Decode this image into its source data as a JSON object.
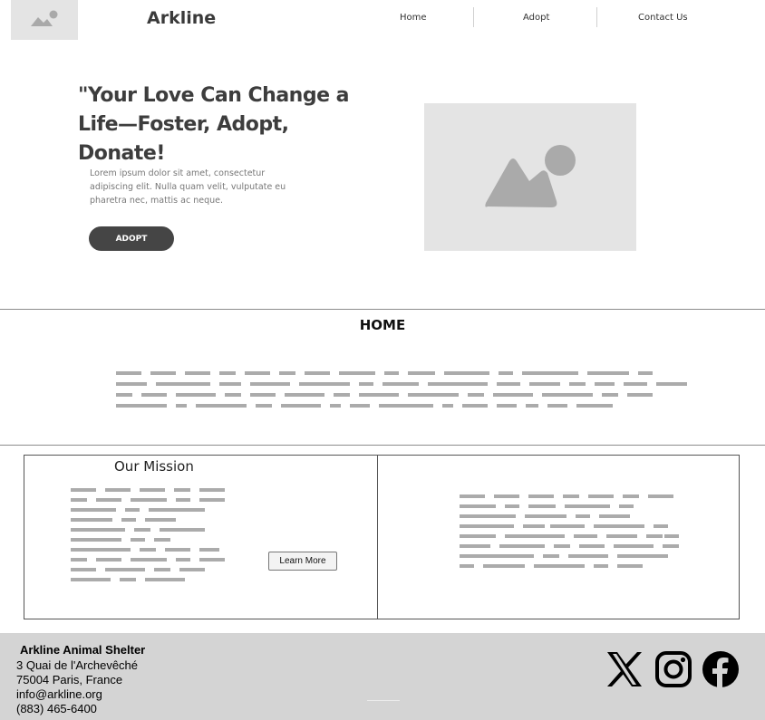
{
  "header": {
    "logo_icon": "image-placeholder-icon",
    "brand": "Arkline",
    "nav": [
      {
        "label": "Home"
      },
      {
        "label": "Adopt"
      },
      {
        "label": "Contact Us"
      }
    ]
  },
  "hero": {
    "title": "\"Your Love Can Change a Life—Foster, Adopt, Donate!",
    "body": "Lorem ipsum dolor sit amet, consectetur adipiscing elit. Nulla quam velit, vulputate eu pharetra nec, mattis ac neque.",
    "button_label": "ADOPT",
    "image_icon": "image-placeholder-icon"
  },
  "home_section": {
    "heading": "HOME"
  },
  "mission": {
    "title": "Our Mission",
    "button_label": "Learn More"
  },
  "footer": {
    "name": "Arkline Animal Shelter",
    "address_line1": "3 Quai de l'Archevêché",
    "address_line2": "75004 Paris, France",
    "email": "info@arkline.org",
    "phone": "(883) 465-6400",
    "social": [
      "x-icon",
      "instagram-icon",
      "facebook-icon"
    ]
  },
  "colors": {
    "accent_dark": "#454545",
    "placeholder": "#e4e4e4",
    "footer_bg": "#d4d4d4",
    "text_line": "#ababab"
  }
}
